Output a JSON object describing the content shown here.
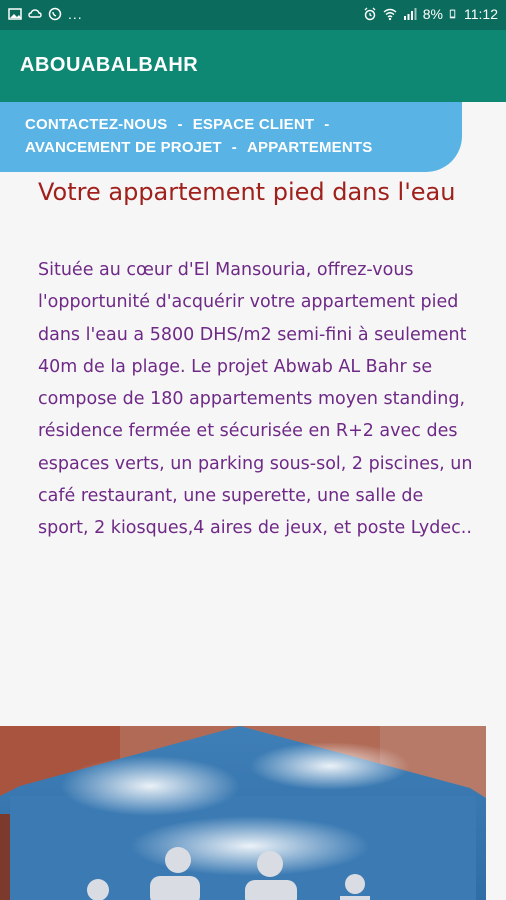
{
  "status_bar": {
    "left_icons": [
      "image-icon",
      "cloud-icon",
      "whatsapp-icon"
    ],
    "dots": "...",
    "battery_percent": "8%",
    "time": "11:12",
    "right_icons": [
      "alarm-icon",
      "wifi-icon",
      "signal-icon",
      "battery-icon"
    ]
  },
  "app_bar": {
    "title": "ABOUABALBAHR",
    "color": "#0f8873"
  },
  "nav": {
    "color": "#59b3e5",
    "row1": [
      {
        "label": "CONTACTEZ-NOUS"
      },
      {
        "label": "ESPACE CLIENT"
      }
    ],
    "row2": [
      {
        "label": "AVANCEMENT DE PROJET"
      },
      {
        "label": "APPARTEMENTS"
      }
    ],
    "separator": "-"
  },
  "content": {
    "title": "Votre appartement pied dans l'eau",
    "body": "Située au cœur d'El Mansouria, offrez-vous l'opportunité d'acquérir votre appartement pied dans l'eau a 5800 DHS/m2 semi-fini à seulement 40m de la plage. Le projet Abwab AL Bahr se compose de 180 appartements moyen standing, résidence fermée et sécurisée en R+2 avec des espaces verts, un parking sous-sol, 2 piscines, un café restaurant, une superette, une salle de sport, 2 kiosques,4 aires de jeux, et poste Lydec..",
    "title_color": "#a0201c",
    "body_color": "#6e2a86"
  }
}
